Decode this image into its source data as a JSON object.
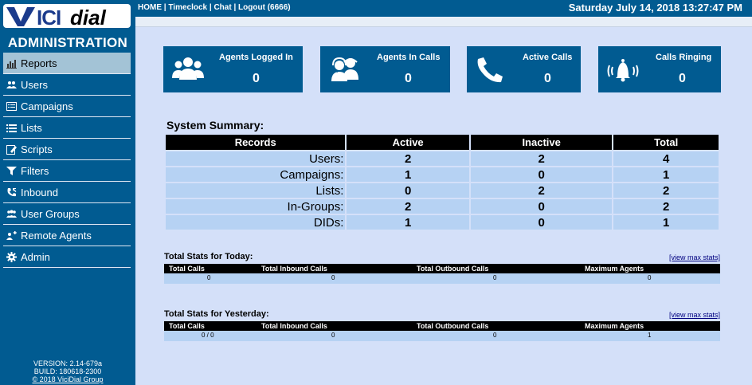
{
  "logo": {
    "text": "VICIdial"
  },
  "sidebar": {
    "title": "ADMINISTRATION",
    "items": [
      {
        "label": "Reports",
        "icon": "reports-icon"
      },
      {
        "label": "Users",
        "icon": "users-icon"
      },
      {
        "label": "Campaigns",
        "icon": "campaigns-icon"
      },
      {
        "label": "Lists",
        "icon": "lists-icon"
      },
      {
        "label": "Scripts",
        "icon": "scripts-icon"
      },
      {
        "label": "Filters",
        "icon": "filter-icon"
      },
      {
        "label": "Inbound",
        "icon": "inbound-phone-icon"
      },
      {
        "label": "User Groups",
        "icon": "user-groups-icon"
      },
      {
        "label": "Remote Agents",
        "icon": "remote-agents-icon"
      },
      {
        "label": "Admin",
        "icon": "gear-icon"
      }
    ],
    "active_item": "Reports",
    "version": "VERSION: 2.14-679a",
    "build": "BUILD: 180618-2300",
    "copyright": "© 2018 ViciDial Group"
  },
  "header": {
    "links": [
      "HOME",
      "Timeclock",
      "Chat",
      "Logout (6666)"
    ],
    "separator": " | ",
    "datetime": "Saturday July 14, 2018 13:27:47 PM"
  },
  "cards": [
    {
      "label": "Agents Logged In",
      "value": "0",
      "icon": "agents-group-icon"
    },
    {
      "label": "Agents In Calls",
      "value": "0",
      "icon": "agents-headset-icon"
    },
    {
      "label": "Active Calls",
      "value": "0",
      "icon": "phone-handset-icon"
    },
    {
      "label": "Calls Ringing",
      "value": "0",
      "icon": "ringing-bell-icon"
    }
  ],
  "summary": {
    "title": "System Summary:",
    "headers": [
      "Records",
      "Active",
      "Inactive",
      "Total"
    ],
    "rows": [
      {
        "label": "Users:",
        "active": "2",
        "inactive": "2",
        "total": "4"
      },
      {
        "label": "Campaigns:",
        "active": "1",
        "inactive": "0",
        "total": "1"
      },
      {
        "label": "Lists:",
        "active": "0",
        "inactive": "2",
        "total": "2"
      },
      {
        "label": "In-Groups:",
        "active": "2",
        "inactive": "0",
        "total": "2"
      },
      {
        "label": "DIDs:",
        "active": "1",
        "inactive": "0",
        "total": "1"
      }
    ]
  },
  "today": {
    "title": "Total Stats for Today:",
    "link": "[view max stats]",
    "headers": [
      "Total Calls",
      "Total Inbound Calls",
      "Total Outbound Calls",
      "Maximum Agents"
    ],
    "values": [
      "0",
      "0",
      "0",
      "0"
    ]
  },
  "yesterday": {
    "title": "Total Stats for Yesterday:",
    "link": "[view max stats]",
    "headers": [
      "Total Calls",
      "Total Inbound Calls",
      "Total Outbound Calls",
      "Maximum Agents"
    ],
    "values": [
      "0 / 0",
      "0",
      "0",
      "1"
    ]
  },
  "colors": {
    "brand_blue": "#015b91",
    "page_bg": "#d4e0f9",
    "row_bg": "#b6d2f3",
    "active_nav": "#a3c3d6"
  }
}
